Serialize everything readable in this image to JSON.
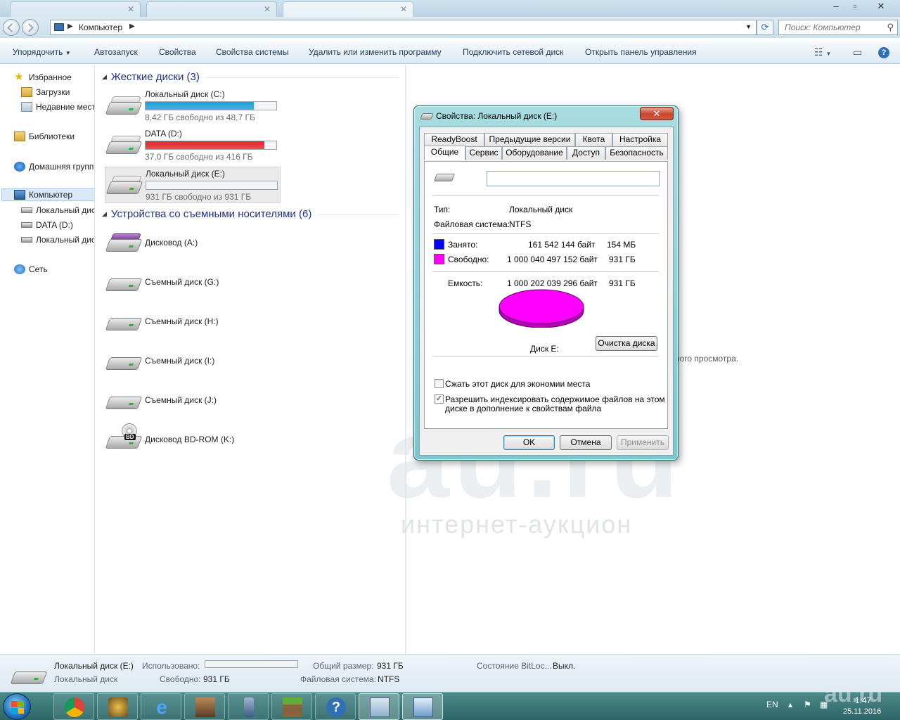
{
  "address": {
    "path": "Компьютер",
    "search_placeholder": "Поиск: Компьютер"
  },
  "toolbar": {
    "organize": "Упорядочить",
    "autoplay": "Автозапуск",
    "properties": "Свойства",
    "system_properties": "Свойства системы",
    "uninstall": "Удалить или изменить программу",
    "map_drive": "Подключить сетевой диск",
    "control_panel": "Открыть панель управления"
  },
  "nav": {
    "favorites": "Избранное",
    "downloads": "Загрузки",
    "recent": "Недавние мест",
    "libraries": "Библиотеки",
    "homegroup": "Домашняя групп",
    "computer": "Компьютер",
    "local_c": "Локальный дис",
    "data_d": "DATA (D:)",
    "local_e": "Локальный дис",
    "network": "Сеть"
  },
  "groups": {
    "hard_disks": "Жесткие диски (3)",
    "removable": "Устройства со съемными носителями (6)"
  },
  "hard_disks": [
    {
      "name": "Локальный диск (C:)",
      "free": "8,42 ГБ свободно из 48,7 ГБ",
      "used_fraction": 0.83,
      "color": "#1f9ed8"
    },
    {
      "name": "DATA (D:)",
      "free": "37,0 ГБ свободно из 416 ГБ",
      "used_fraction": 0.91,
      "color": "#e8232f"
    },
    {
      "name": "Локальный диск (E:)",
      "free": "931 ГБ свободно из 931 ГБ",
      "used_fraction": 0.0,
      "color": "#1f9ed8"
    }
  ],
  "removable": [
    {
      "name": "Дисковод (A:)"
    },
    {
      "name": "Съемный диск (G:)"
    },
    {
      "name": "Съемный диск (H:)"
    },
    {
      "name": "Съемный диск (I:)"
    },
    {
      "name": "Съемный диск (J:)"
    },
    {
      "name": "Дисковод BD-ROM (K:)"
    }
  ],
  "preview_text": "ного просмотра.",
  "details": {
    "name": "Локальный диск (E:)",
    "type": "Локальный диск",
    "used_label": "Использовано:",
    "free_label": "Свободно:",
    "free_value": "931 ГБ",
    "total_label": "Общий размер:",
    "total_value": "931 ГБ",
    "fs_label": "Файловая система:",
    "fs_value": "NTFS",
    "bitlocker_label": "Состояние BitLoc...",
    "bitlocker_value": "Выкл."
  },
  "dialog": {
    "title": "Свойства: Локальный диск (E:)",
    "tabs_row1": [
      "ReadyBoost",
      "Предыдущие версии",
      "Квота",
      "Настройка"
    ],
    "tabs_row2": [
      "Общие",
      "Сервис",
      "Оборудование",
      "Доступ",
      "Безопасность"
    ],
    "active_tab": "Общие",
    "type_label": "Тип:",
    "type_value": "Локальный диск",
    "fs_label": "Файловая система:",
    "fs_value": "NTFS",
    "used_label": "Занято:",
    "used_bytes": "161 542 144 байт",
    "used_short": "154 МБ",
    "free_label": "Свободно:",
    "free_bytes": "1 000 040 497 152 байт",
    "free_short": "931 ГБ",
    "capacity_label": "Емкость:",
    "capacity_bytes": "1 000 202 039 296 байт",
    "capacity_short": "931 ГБ",
    "used_color": "#0000ff",
    "free_color": "#ff00ff",
    "disk_caption": "Диск E:",
    "cleanup_button": "Очистка диска",
    "compress_label": "Сжать этот диск для экономии места",
    "compress_checked": false,
    "index_label_1": "Разрешить индексировать содержимое файлов на этом",
    "index_label_2": "диске в дополнение к свойствам файла",
    "index_checked": true,
    "ok": "OK",
    "cancel": "Отмена",
    "apply": "Применить"
  },
  "tray": {
    "lang": "EN",
    "time": "1:47",
    "date": "25.11.2016"
  },
  "watermark": {
    "big": "au.ru",
    "small": "интернет-аукцион",
    "corner": "au.ru"
  }
}
